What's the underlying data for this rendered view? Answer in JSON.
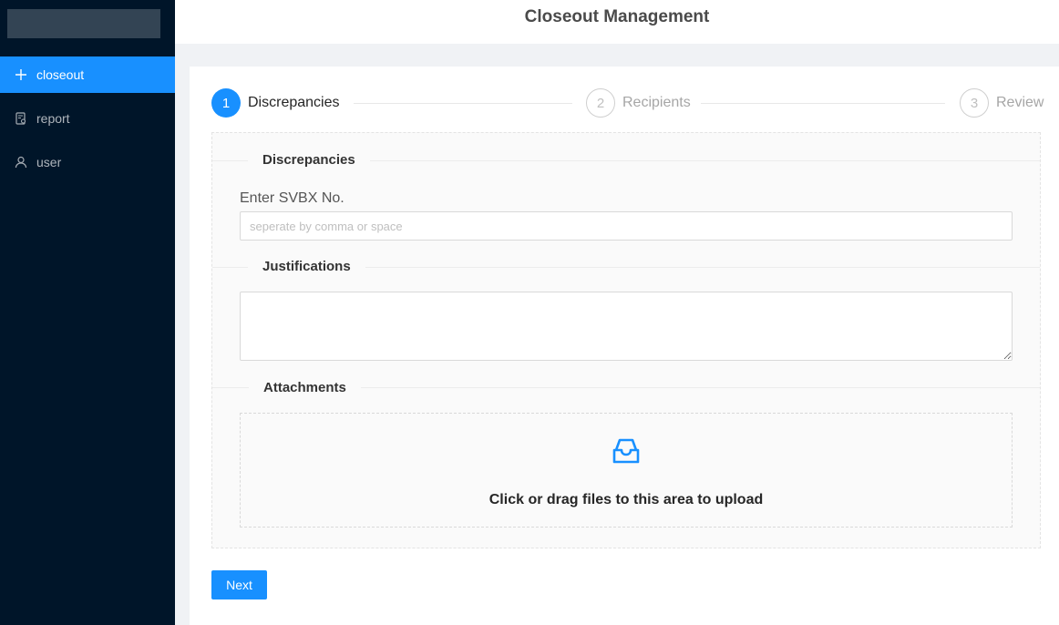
{
  "app": {
    "title": "Closeout Management"
  },
  "sidebar": {
    "items": [
      {
        "label": "closeout",
        "icon": "plus-icon",
        "active": true
      },
      {
        "label": "report",
        "icon": "report-icon",
        "active": false
      },
      {
        "label": "user",
        "icon": "user-icon",
        "active": false
      }
    ]
  },
  "steps": [
    {
      "number": "1",
      "title": "Discrepancies",
      "status": "active"
    },
    {
      "number": "2",
      "title": "Recipients",
      "status": "wait"
    },
    {
      "number": "3",
      "title": "Review",
      "status": "wait"
    }
  ],
  "form": {
    "discrepancies": {
      "section_title": "Discrepancies",
      "label": "Enter SVBX No.",
      "placeholder": "seperate by comma or space",
      "value": ""
    },
    "justifications": {
      "section_title": "Justifications",
      "value": ""
    },
    "attachments": {
      "section_title": "Attachments",
      "upload_text": "Click or drag files to this area to upload",
      "icon": "inbox-icon"
    }
  },
  "actions": {
    "next_label": "Next"
  },
  "colors": {
    "sidebar_bg": "#001529",
    "primary": "#1890ff",
    "content_bg": "#f0f2f5"
  }
}
